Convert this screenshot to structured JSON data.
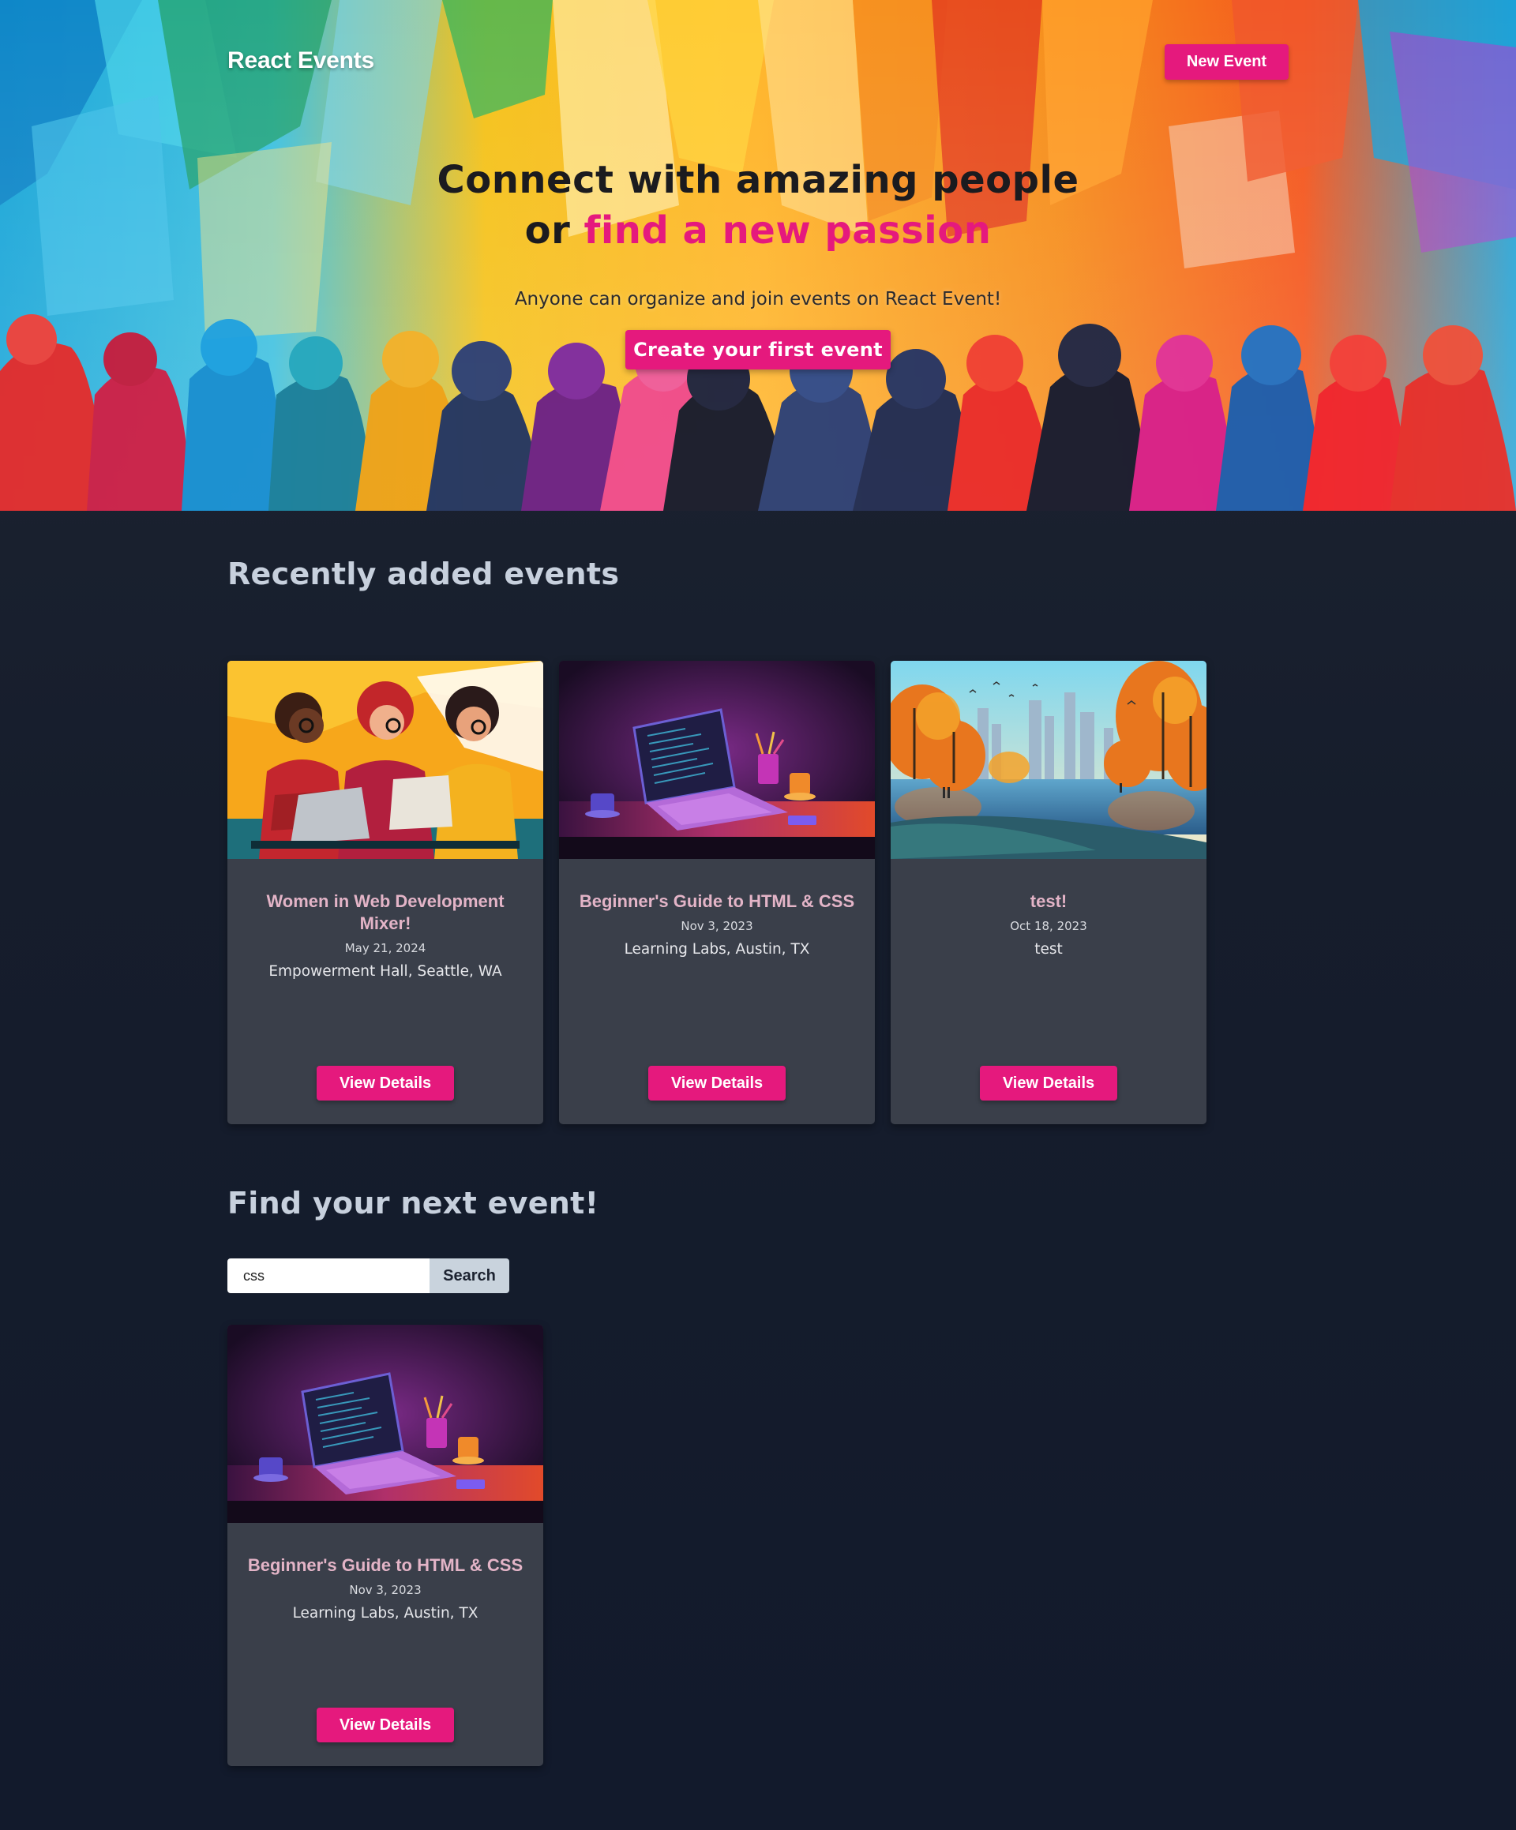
{
  "header": {
    "brand": "React Events",
    "new_event_label": "New Event"
  },
  "hero": {
    "title_line1": "Connect with amazing people",
    "title_line2_prefix": "or ",
    "title_line2_accent": "find a new passion",
    "subtitle": "Anyone can organize and join events on React Event!",
    "cta_label": "Create your first event"
  },
  "recent": {
    "heading": "Recently added events",
    "events": [
      {
        "title": "Women in Web Development Mixer!",
        "date": "May 21, 2024",
        "location": "Empowerment Hall, Seattle, WA",
        "button": "View Details",
        "image": "women-coding-illustration"
      },
      {
        "title": "Beginner's Guide to HTML & CSS",
        "date": "Nov 3, 2023",
        "location": "Learning Labs, Austin, TX",
        "button": "View Details",
        "image": "laptop-desk-illustration"
      },
      {
        "title": "test!",
        "date": "Oct 18, 2023",
        "location": "test",
        "button": "View Details",
        "image": "autumn-city-park-illustration"
      }
    ]
  },
  "search": {
    "heading": "Find your next event!",
    "value": "css",
    "button": "Search",
    "results": [
      {
        "title": "Beginner's Guide to HTML & CSS",
        "date": "Nov 3, 2023",
        "location": "Learning Labs, Austin, TX",
        "button": "View Details",
        "image": "laptop-desk-illustration"
      }
    ]
  },
  "colors": {
    "accent": "#e5197d",
    "page_bg": "#161d2c",
    "card_bg": "#3a3f4a",
    "card_title": "#e3b4c7"
  }
}
